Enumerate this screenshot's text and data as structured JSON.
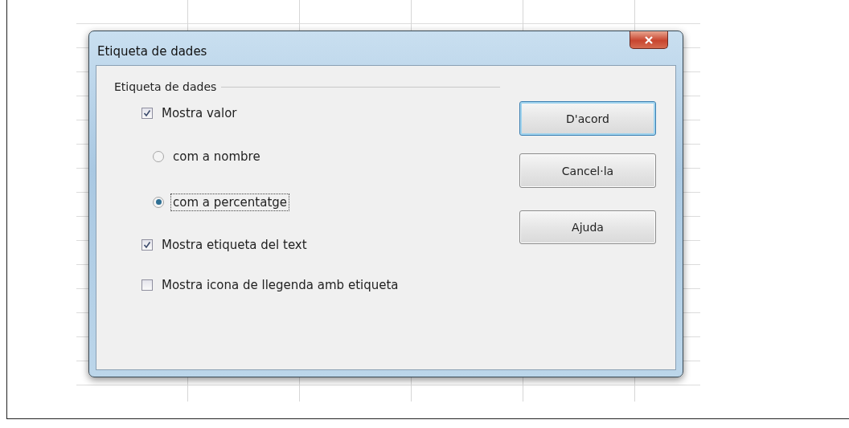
{
  "window": {
    "title": "Etiqueta de dades"
  },
  "group": {
    "label": "Etiqueta de dades"
  },
  "options": [
    {
      "kind": "checkbox",
      "label": "Mostra valor",
      "checked": true,
      "focused": false
    },
    {
      "kind": "radio",
      "label": "com a nombre",
      "selected": false,
      "focused": false
    },
    {
      "kind": "radio",
      "label": "com a percentatge",
      "selected": true,
      "focused": true
    },
    {
      "kind": "checkbox",
      "label": "Mostra etiqueta del text",
      "checked": true,
      "focused": false
    },
    {
      "kind": "checkbox",
      "label": "Mostra icona de llegenda amb etiqueta",
      "checked": false,
      "focused": false
    }
  ],
  "buttons": [
    {
      "label": "D'acord",
      "default": true
    },
    {
      "label": "Cancel·la",
      "default": false
    },
    {
      "label": "Ajuda",
      "default": false
    }
  ]
}
